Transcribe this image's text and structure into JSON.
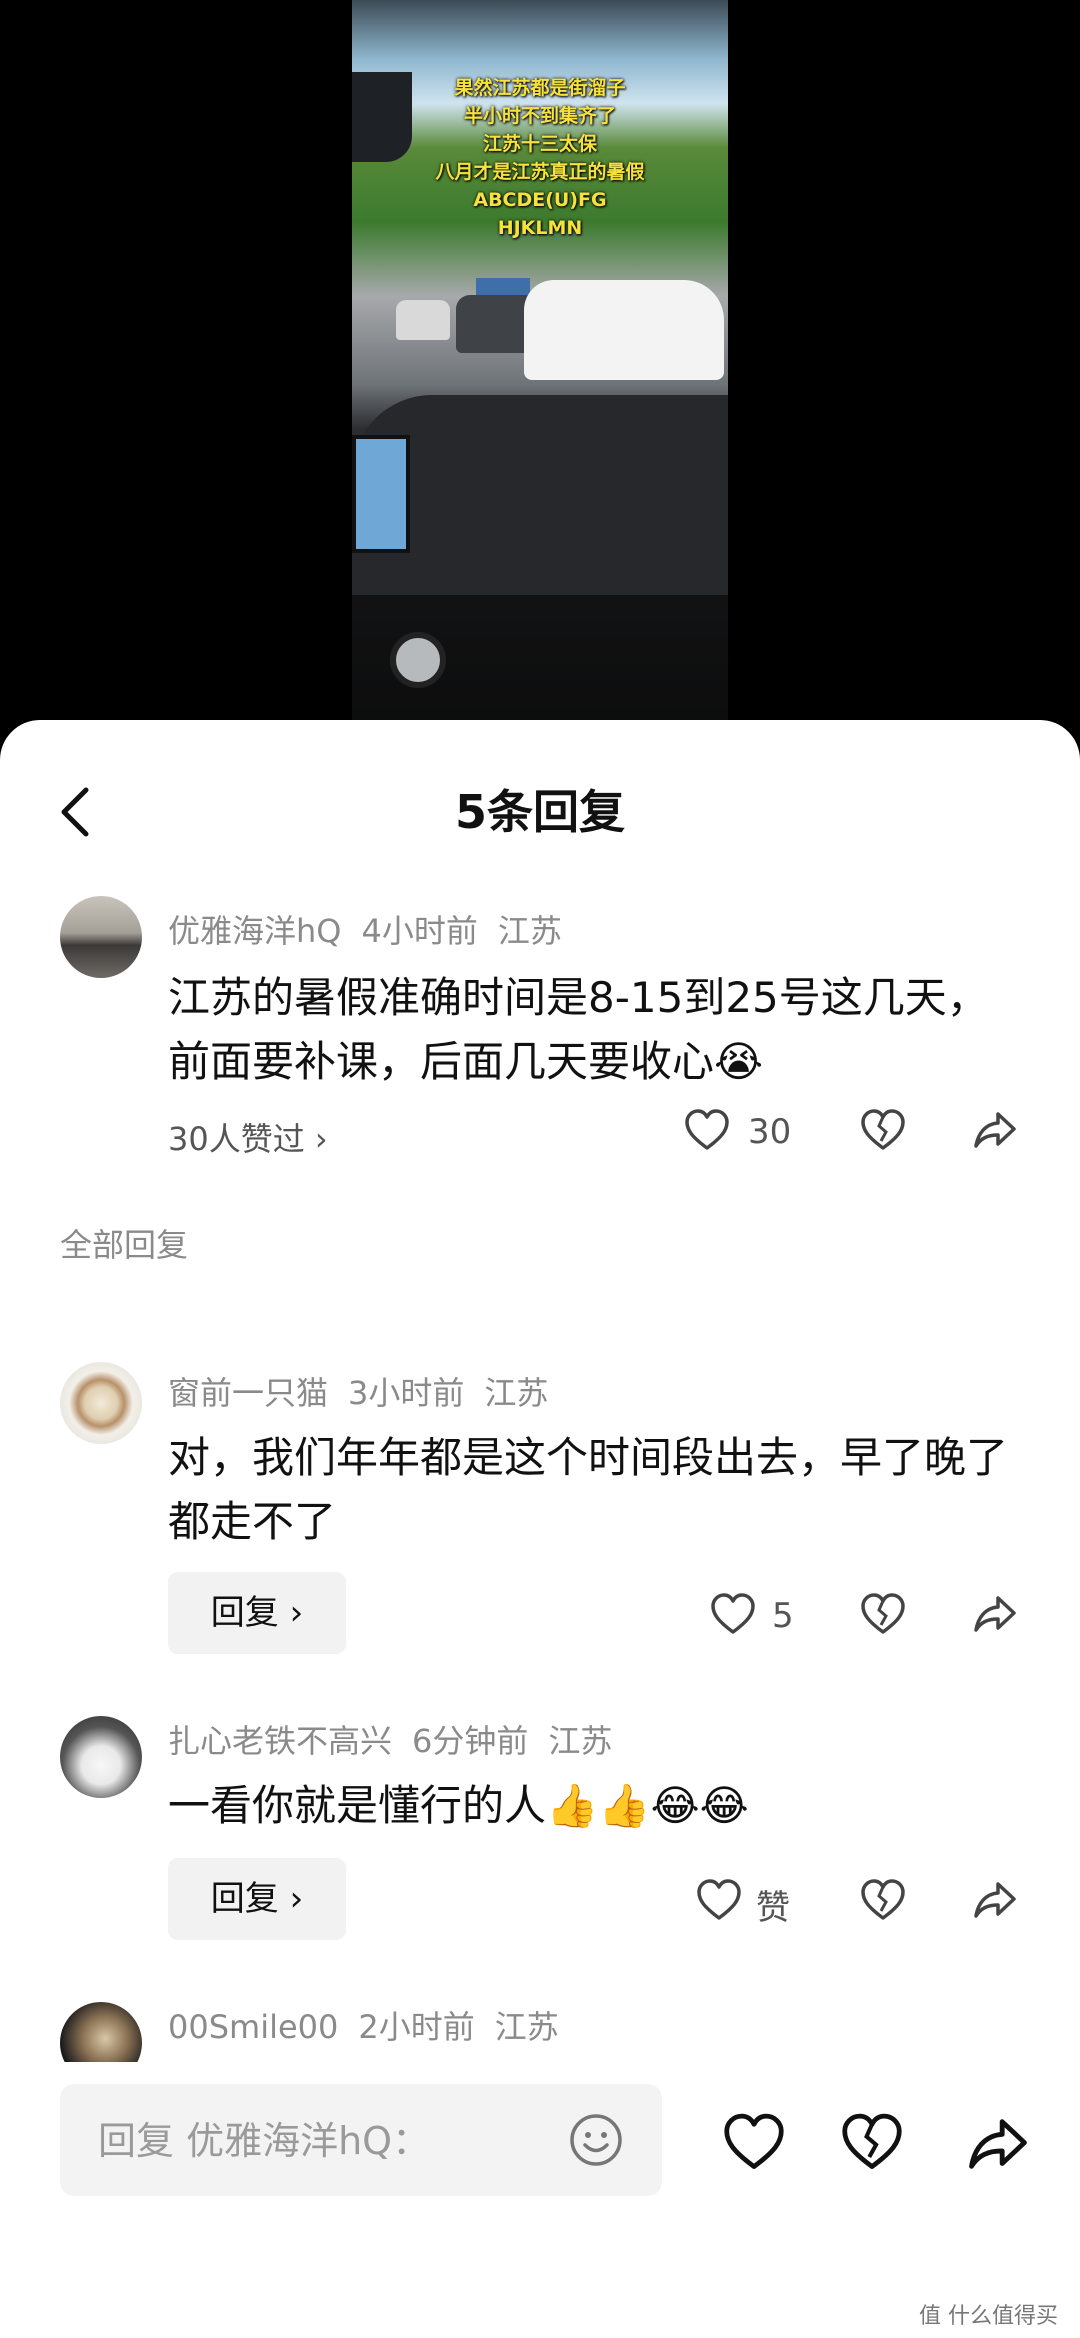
{
  "video": {
    "overlay_lines": [
      "果然江苏都是街溜子",
      "半小时不到集齐了",
      "江苏十三太保",
      "八月才是江苏真正的暑假",
      "ABCDE(U)FG",
      "HJKLMN"
    ]
  },
  "header": {
    "title": "5条回复"
  },
  "main_comment": {
    "username": "优雅海洋hQ",
    "time": "4小时前",
    "location": "江苏",
    "text": "江苏的暑假准确时间是8-15到25号这几天，前面要补课，后面几天要收心😭",
    "likes_link": "30人赞过 ›",
    "like_count": "30"
  },
  "section_label": "全部回复",
  "replies": [
    {
      "username": "窗前一只猫",
      "time": "3小时前",
      "location": "江苏",
      "text": "对，我们年年都是这个时间段出去，早了晚了都走不了",
      "reply_label": "回复 ›",
      "like_count": "5"
    },
    {
      "username": "扎心老铁不高兴",
      "time": "6分钟前",
      "location": "江苏",
      "text": "一看你就是懂行的人👍👍😂😂",
      "reply_label": "回复 ›",
      "like_count": "赞"
    },
    {
      "username": "00Smile00",
      "time": "2小时前",
      "location": "江苏"
    }
  ],
  "bottom_bar": {
    "input_placeholder": "回复 优雅海洋hQ："
  },
  "watermark": "值 什么值得买",
  "colors": {
    "accent_gray": "#8a8a8a",
    "sheet_bg": "#ffffff",
    "overlay_text": "#f6e23c"
  }
}
